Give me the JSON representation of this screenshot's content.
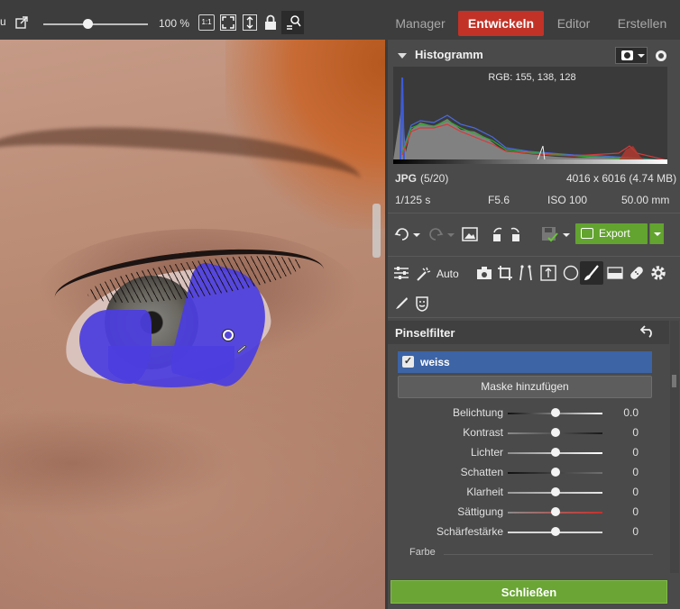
{
  "toolbar": {
    "partial_label": "u",
    "zoom_level": "100 %",
    "zoom_fraction": 0.42,
    "one_to_one_label": "1:1"
  },
  "modes": {
    "manager": "Manager",
    "develop": "Entwickeln",
    "editor": "Editor",
    "create": "Erstellen"
  },
  "histogram": {
    "title": "Histogramm",
    "rgb": "RGB: 155, 138, 128"
  },
  "file_info": {
    "format": "JPG",
    "index": "(5/20)",
    "dimensions": "4016 x 6016 (4.74 MB)",
    "shutter": "1/125 s",
    "aperture": "F5.6",
    "iso": "ISO 100",
    "focal": "50.00 mm"
  },
  "actions": {
    "export_label": "Export",
    "auto_label": "Auto"
  },
  "filter": {
    "title": "Pinselfilter",
    "mask_name": "weiss",
    "add_mask_label": "Maske hinzufügen",
    "sliders": [
      {
        "label": "Belichtung",
        "value": "0.0"
      },
      {
        "label": "Kontrast",
        "value": "0"
      },
      {
        "label": "Lichter",
        "value": "0"
      },
      {
        "label": "Schatten",
        "value": "0"
      },
      {
        "label": "Klarheit",
        "value": "0"
      },
      {
        "label": "Sättigung",
        "value": "0"
      },
      {
        "label": "Schärfestärke",
        "value": "0"
      }
    ],
    "color_section": "Farbe",
    "close_label": "Schließen"
  },
  "colors": {
    "develop_tab": "#c23227",
    "export_button": "#63a32f",
    "mask_row": "#3d64a5",
    "close_button": "#6aa535",
    "brush_mask": "#4b3ddf"
  }
}
